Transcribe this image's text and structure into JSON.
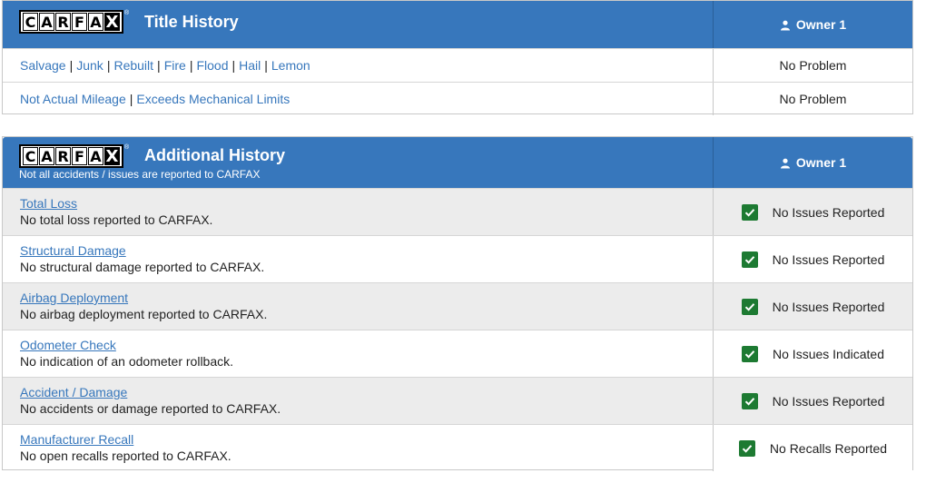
{
  "brand": {
    "logo_letters": [
      "C",
      "A",
      "R",
      "F",
      "A",
      "X"
    ],
    "accent": "#3777bc",
    "check_color": "#1d7a32"
  },
  "title_history": {
    "title": "Title History",
    "owner_label": "Owner 1",
    "rows": [
      {
        "links": [
          "Salvage",
          "Junk",
          "Rebuilt",
          "Fire",
          "Flood",
          "Hail",
          "Lemon"
        ],
        "status": "No Problem"
      },
      {
        "links": [
          "Not Actual Mileage",
          "Exceeds Mechanical Limits"
        ],
        "status": "No Problem"
      }
    ]
  },
  "additional_history": {
    "title": "Additional History",
    "subtitle": "Not all accidents / issues are reported to CARFAX",
    "owner_label": "Owner 1",
    "rows": [
      {
        "title": "Total Loss",
        "description": "No total loss reported to CARFAX.",
        "status": "No Issues Reported",
        "icon": "check-icon"
      },
      {
        "title": "Structural Damage",
        "description": "No structural damage reported to CARFAX.",
        "status": "No Issues Reported",
        "icon": "check-icon"
      },
      {
        "title": "Airbag Deployment",
        "description": "No airbag deployment reported to CARFAX.",
        "status": "No Issues Reported",
        "icon": "check-icon"
      },
      {
        "title": "Odometer Check",
        "description": "No indication of an odometer rollback.",
        "status": "No Issues Indicated",
        "icon": "check-icon"
      },
      {
        "title": "Accident / Damage",
        "description": "No accidents or damage reported to CARFAX.",
        "status": "No Issues Reported",
        "icon": "check-icon"
      },
      {
        "title": "Manufacturer Recall",
        "description": "No open recalls reported to CARFAX.",
        "status": "No Recalls Reported",
        "icon": "check-icon"
      }
    ]
  }
}
